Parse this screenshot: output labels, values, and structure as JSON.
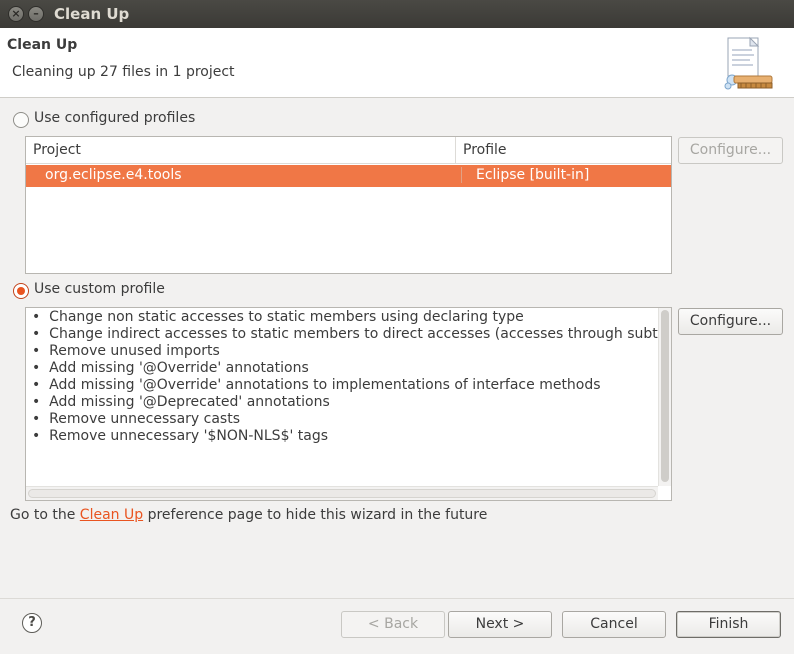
{
  "window": {
    "title": "Clean Up"
  },
  "header": {
    "title": "Clean Up",
    "message": "Cleaning up 27 files in 1 project",
    "icon": "clean-up-wizard-icon"
  },
  "configured": {
    "label": "Use configured profiles",
    "selected": false,
    "columns": [
      "Project",
      "Profile"
    ],
    "rows": [
      {
        "project": "org.eclipse.e4.tools",
        "profile": "Eclipse [built-in]"
      }
    ],
    "configure_label": "Configure...",
    "configure_enabled": false
  },
  "custom": {
    "label": "Use custom profile",
    "selected": true,
    "configure_label": "Configure...",
    "bullet": "•",
    "items": [
      "Change non static accesses to static members using declaring type",
      "Change indirect accesses to static members to direct accesses (accesses through subtypes)",
      "Remove unused imports",
      "Add missing '@Override' annotations",
      "Add missing '@Override' annotations to implementations of interface methods",
      "Add missing '@Deprecated' annotations",
      "Remove unnecessary casts",
      "Remove unnecessary '$NON-NLS$' tags"
    ]
  },
  "footer_note": {
    "before": "Go to the ",
    "link": "Clean Up",
    "after": " preference page to hide this wizard in the future"
  },
  "buttons": {
    "help": "?",
    "back": "< Back",
    "next": "Next >",
    "cancel": "Cancel",
    "finish": "Finish"
  },
  "colors": {
    "accent": "#e95420",
    "selection": "#f07746"
  }
}
